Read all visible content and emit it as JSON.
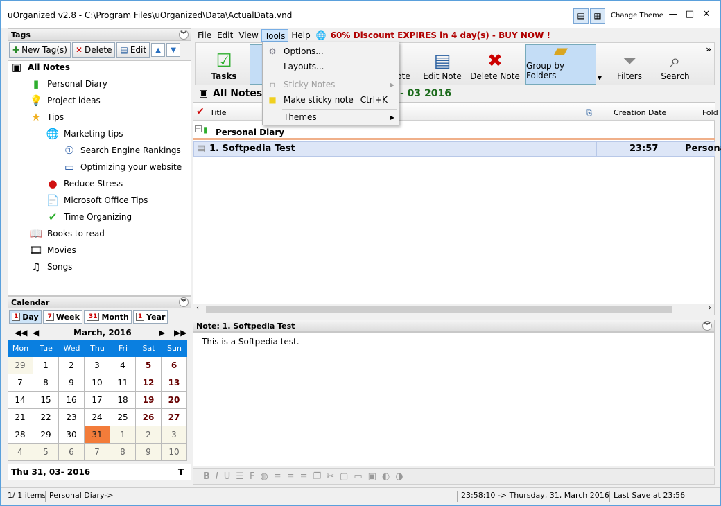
{
  "window": {
    "title": "uOrganized v2.8 - C:\\Program Files\\uOrganized\\Data\\ActualData.vnd",
    "change_theme": "Change Theme",
    "minimize": "—",
    "maximize": "□",
    "close": "✕"
  },
  "tags": {
    "header": "Tags",
    "new_tag": "New Tag(s)",
    "delete": "Delete",
    "edit": "Edit",
    "all_notes": "All Notes",
    "items": [
      {
        "label": "Personal Diary",
        "icon": "▮"
      },
      {
        "label": "Project ideas",
        "icon": "💡"
      },
      {
        "label": "Tips",
        "icon": "★"
      },
      {
        "label": "Marketing tips",
        "icon": "🌐"
      },
      {
        "label": "Search Engine Rankings",
        "icon": "①"
      },
      {
        "label": "Optimizing your website",
        "icon": "▭"
      },
      {
        "label": "Reduce Stress",
        "icon": "●"
      },
      {
        "label": "Microsoft Office Tips",
        "icon": "📄"
      },
      {
        "label": "Time Organizing",
        "icon": "✔"
      },
      {
        "label": "Books to read",
        "icon": "📖"
      },
      {
        "label": "Movies",
        "icon": "🎞"
      },
      {
        "label": "Songs",
        "icon": "♫"
      }
    ]
  },
  "calendar": {
    "header": "Calendar",
    "tabs": [
      {
        "num": "1",
        "label": "Day"
      },
      {
        "num": "7",
        "label": "Week"
      },
      {
        "num": "31",
        "label": "Month"
      },
      {
        "num": "1",
        "label": "Year"
      }
    ],
    "month_label": "March, 2016",
    "weekdays": [
      "Mon",
      "Tue",
      "Wed",
      "Thu",
      "Fri",
      "Sat",
      "Sun"
    ],
    "days": [
      "29",
      "1",
      "2",
      "3",
      "4",
      "5",
      "6",
      "7",
      "8",
      "9",
      "10",
      "11",
      "12",
      "13",
      "14",
      "15",
      "16",
      "17",
      "18",
      "19",
      "20",
      "21",
      "22",
      "23",
      "24",
      "25",
      "26",
      "27",
      "28",
      "29",
      "30",
      "31",
      "1",
      "2",
      "3",
      "4",
      "5",
      "6",
      "7",
      "8",
      "9",
      "10"
    ],
    "footer_date": "Thu 31, 03- 2016",
    "footer_today": "T"
  },
  "menu": {
    "file": "File",
    "edit": "Edit",
    "view": "View",
    "tools": "Tools",
    "help": "Help",
    "promo": "60% Discount EXPIRES in 4 day(s) - BUY NOW !"
  },
  "toolbar": {
    "tasks": "Tasks",
    "note_partial": "ote",
    "edit_note": "Edit Note",
    "delete_note": "Delete Note",
    "group_by_folders": "Group by Folders",
    "filters": "Filters",
    "search": "Search",
    "more": "»"
  },
  "tools_menu": {
    "options": "Options...",
    "layouts": "Layouts...",
    "sticky_notes": "Sticky Notes",
    "make_sticky": "Make sticky note",
    "make_sticky_shortcut": "Ctrl+K",
    "themes": "Themes"
  },
  "content": {
    "title": "All Notes",
    "date_range": "- 03 2016",
    "columns": {
      "title": "Title",
      "creation_date": "Creation Date",
      "folder": "Fold"
    },
    "group": "Personal Diary",
    "row": {
      "title": "1. Softpedia Test",
      "time": "23:57",
      "folder": "Persona"
    }
  },
  "note": {
    "header": "Note: 1. Softpedia Test",
    "body": "This is a Softpedia test."
  },
  "status": {
    "items": "1/ 1 items",
    "path": "Personal Diary->",
    "datetime": "23:58:10  ->  Thursday, 31, March 2016",
    "last_save": "Last Save at 23:56"
  }
}
